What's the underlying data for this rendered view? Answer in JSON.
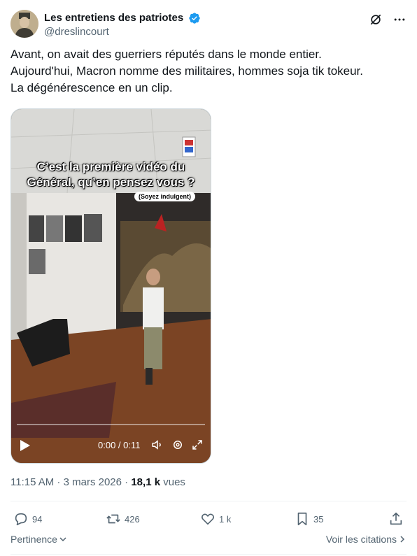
{
  "author": {
    "display_name": "Les entretiens des patriotes",
    "handle": "@dreslincourt",
    "verified": true,
    "avatar_icon": "avatar-portrait"
  },
  "tweet": {
    "lines": [
      "Avant, on avait des guerriers réputés dans le monde entier.",
      "Aujourd'hui, Macron nomme des militaires, hommes soja tik tokeur.",
      "La dégénérescence en un clip."
    ]
  },
  "video": {
    "caption_line1": "C’est la première vidéo du",
    "caption_line2": "Général, qu’en pensez vous ?",
    "sub_caption": "(Soyez indulgent)",
    "time": "0:00 / 0:11",
    "progress": 0
  },
  "meta": {
    "time": "11:15 AM",
    "sep1": " · ",
    "date": "3 mars 2026",
    "sep2": " · ",
    "views_count": "18,1 k",
    "views_label": " vues"
  },
  "actions": {
    "replies": "94",
    "reposts": "426",
    "likes": "1 k",
    "bookmarks": "35"
  },
  "footer": {
    "relevance": "Pertinence",
    "quotes": "Voir les citations"
  },
  "colors": {
    "text": "#0f1419",
    "secondary": "#536471",
    "verified": "#1d9bf0",
    "divider": "#eff3f4"
  }
}
